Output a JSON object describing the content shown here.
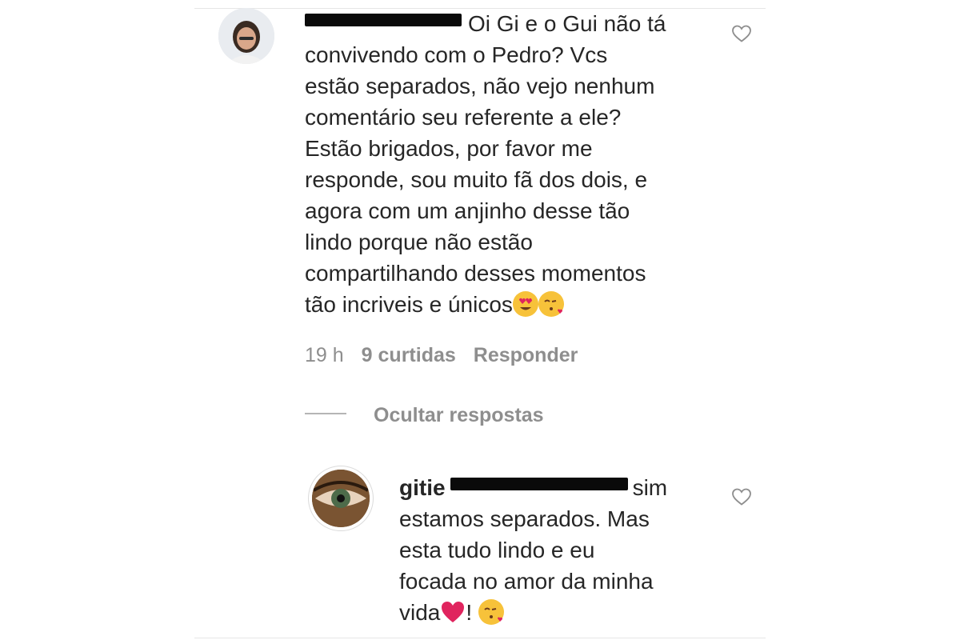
{
  "comment": {
    "text_line1": "Oi Gi e o Gui não tá",
    "text_rest": [
      "convivendo com o Pedro? Vcs",
      "estão separados, não vejo nenhum",
      "comentário seu referente a ele?",
      "Estão brigados, por favor me",
      "responde, sou muito fã dos dois, e",
      "agora com um anjinho desse tão",
      "lindo porque não estão",
      "compartilhando desses momentos",
      "tão incriveis e únicos"
    ],
    "emojis": [
      "heart-eyes-emoji",
      "kissing-heart-emoji"
    ],
    "time": "19 h",
    "likes": "9 curtidas",
    "reply_label": "Responder"
  },
  "hide_replies_label": "Ocultar respostas",
  "reply": {
    "username": "gitie",
    "text_line1_suffix": "sim",
    "text_rest": [
      "estamos separados. Mas",
      "esta tudo lindo e eu",
      "focada no amor da minha"
    ],
    "last_line_prefix": "vida",
    "last_line_punct": "!",
    "emojis": [
      "red-heart-emoji",
      "kissing-heart-emoji"
    ]
  },
  "colors": {
    "text": "#262626",
    "secondary": "#8e8e8e",
    "heart_red": "#e0245e",
    "emoji_yellow": "#f7c23a"
  }
}
